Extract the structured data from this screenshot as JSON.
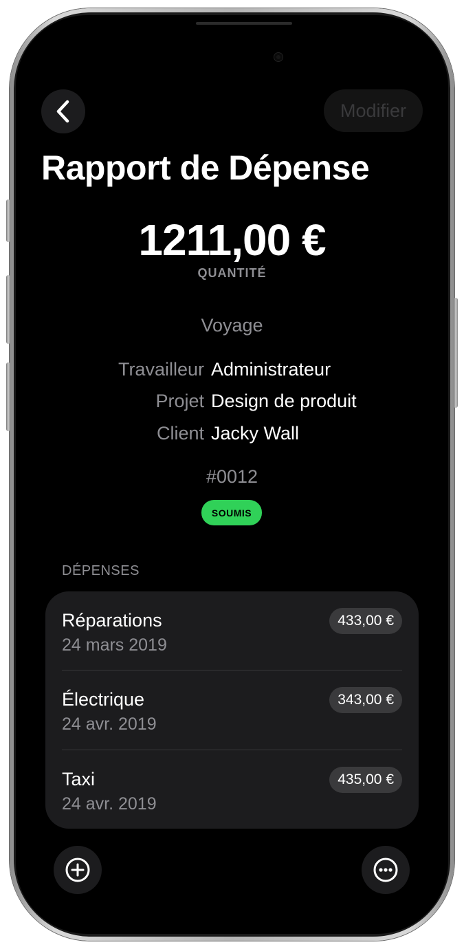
{
  "header": {
    "back_icon": "chevron-left-icon",
    "modify_label": "Modifier",
    "title": "Rapport de Dépense"
  },
  "summary": {
    "amount": "1211,00 €",
    "amount_label": "QUANTITÉ",
    "category": "Voyage"
  },
  "details": [
    {
      "label": "Travailleur",
      "value": "Administrateur"
    },
    {
      "label": "Projet",
      "value": "Design de produit"
    },
    {
      "label": "Client",
      "value": "Jacky Wall"
    }
  ],
  "report": {
    "number": "#0012",
    "status": "SOUMIS",
    "status_color": "#30d158"
  },
  "expenses": {
    "header": "DÉPENSES",
    "items": [
      {
        "name": "Réparations",
        "date": "24 mars 2019",
        "amount": "433,00 €"
      },
      {
        "name": "Électrique",
        "date": "24 avr. 2019",
        "amount": "343,00 €"
      },
      {
        "name": "Taxi",
        "date": "24 avr. 2019",
        "amount": "435,00 €"
      }
    ]
  },
  "toolbar": {
    "add_icon": "plus-circle-icon",
    "more_icon": "ellipsis-circle-icon"
  },
  "colors": {
    "background": "#000000",
    "card": "#1c1c1e",
    "secondary_text": "#8e8e93",
    "accent_green": "#30d158"
  }
}
